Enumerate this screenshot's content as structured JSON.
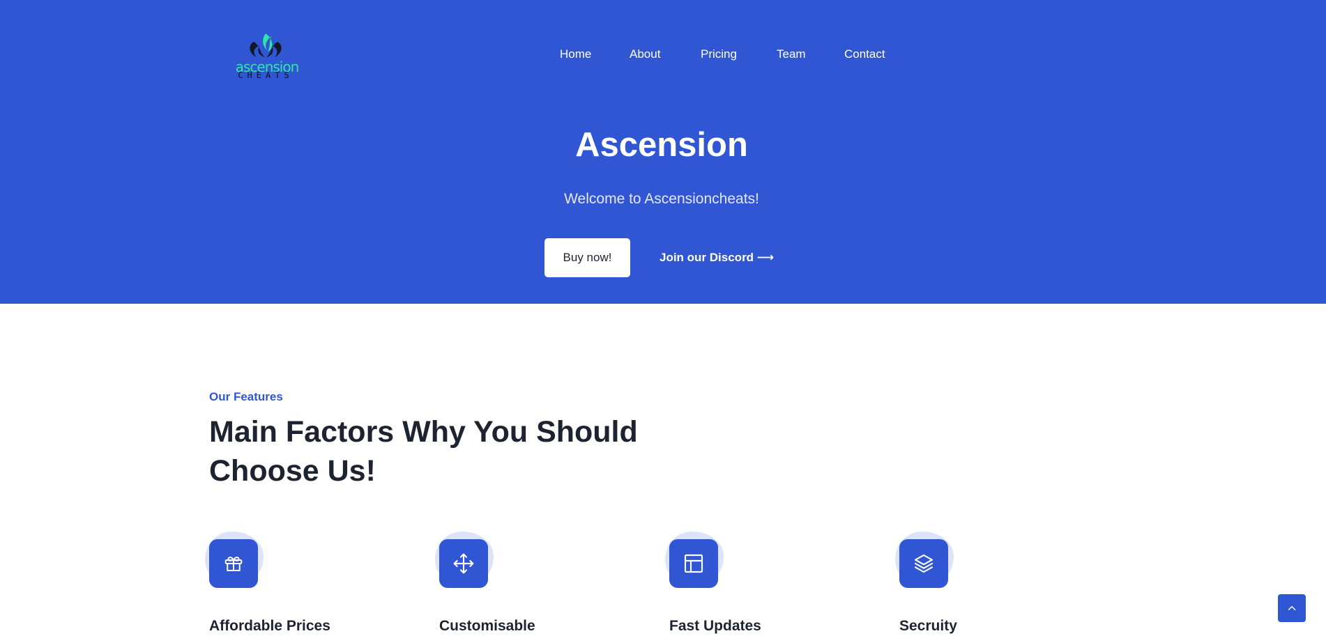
{
  "brand": {
    "logo_icon": "ascension-flame-logo",
    "logo_word_top": "ascension",
    "logo_word_bottom": "CHEATS"
  },
  "nav": {
    "items": [
      {
        "label": "Home"
      },
      {
        "label": "About"
      },
      {
        "label": "Pricing"
      },
      {
        "label": "Team"
      },
      {
        "label": "Contact"
      }
    ]
  },
  "hero": {
    "title": "Ascension",
    "subtitle": "Welcome to Ascensioncheats!",
    "primary_button": "Buy now!",
    "secondary_link": "Join our Discord ⟶"
  },
  "features": {
    "kicker": "Our Features",
    "title": "Main Factors Why You Should Choose Us!",
    "items": [
      {
        "title": "Affordable Prices",
        "icon": "gift-icon"
      },
      {
        "title": "Customisable",
        "icon": "move-arrows-icon"
      },
      {
        "title": "Fast Updates",
        "icon": "layout-icon"
      },
      {
        "title": "Secruity",
        "icon": "layers-icon"
      }
    ]
  },
  "scroll_top": {
    "icon": "chevron-up-icon"
  },
  "colors": {
    "primary": "#3056d3",
    "heading": "#1d2431",
    "white": "#ffffff"
  }
}
